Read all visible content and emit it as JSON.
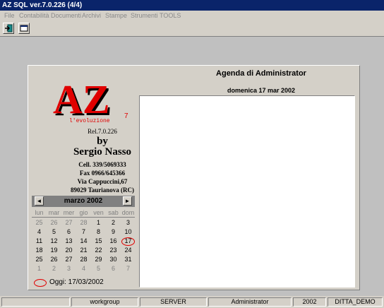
{
  "window": {
    "title": "AZ SQL ver.7.0.226 (4/4)"
  },
  "menu": [
    {
      "label": "File"
    },
    {
      "label": "Contabilità"
    },
    {
      "label": "Documenti"
    },
    {
      "label": "Archivi"
    },
    {
      "label": "Stampe"
    },
    {
      "label": "Strumenti"
    },
    {
      "label": "TOOLS"
    }
  ],
  "toolbar": [
    {
      "icon": "exit-door-icon"
    },
    {
      "icon": "window-icon"
    }
  ],
  "logo": {
    "text": "AZ",
    "superscript": "7",
    "tagline": "l'evoluzione",
    "colors": {
      "red": "#e00000",
      "black": "#000000"
    }
  },
  "info": {
    "release": "Rel.7.0.226",
    "by": "by",
    "author": "Sergio Nasso",
    "contacts": [
      "Cell. 339/5069333",
      "Fax 0966/645366",
      "Via Cappuccini,67",
      "89029 Taurianova (RC)"
    ]
  },
  "agenda": {
    "title": "Agenda di Administrator",
    "date": "domenica 17 mar 2002"
  },
  "calendar": {
    "month": "marzo 2002",
    "prev": "◄",
    "next": "►",
    "weekdays": [
      "lun",
      "mar",
      "mer",
      "gio",
      "ven",
      "sab",
      "dom"
    ],
    "weeks": [
      [
        {
          "d": "25",
          "o": true
        },
        {
          "d": "26",
          "o": true
        },
        {
          "d": "27",
          "o": true
        },
        {
          "d": "28",
          "o": true
        },
        {
          "d": "1"
        },
        {
          "d": "2"
        },
        {
          "d": "3"
        }
      ],
      [
        {
          "d": "4"
        },
        {
          "d": "5"
        },
        {
          "d": "6"
        },
        {
          "d": "7"
        },
        {
          "d": "8"
        },
        {
          "d": "9"
        },
        {
          "d": "10"
        }
      ],
      [
        {
          "d": "11"
        },
        {
          "d": "12"
        },
        {
          "d": "13"
        },
        {
          "d": "14"
        },
        {
          "d": "15"
        },
        {
          "d": "16"
        },
        {
          "d": "17",
          "sel": true
        }
      ],
      [
        {
          "d": "18"
        },
        {
          "d": "19"
        },
        {
          "d": "20"
        },
        {
          "d": "21"
        },
        {
          "d": "22"
        },
        {
          "d": "23"
        },
        {
          "d": "24"
        }
      ],
      [
        {
          "d": "25"
        },
        {
          "d": "26"
        },
        {
          "d": "27"
        },
        {
          "d": "28"
        },
        {
          "d": "29"
        },
        {
          "d": "30"
        },
        {
          "d": "31"
        }
      ],
      [
        {
          "d": "1",
          "o": true
        },
        {
          "d": "2",
          "o": true
        },
        {
          "d": "3",
          "o": true
        },
        {
          "d": "4",
          "o": true
        },
        {
          "d": "5",
          "o": true
        },
        {
          "d": "6",
          "o": true
        },
        {
          "d": "7",
          "o": true
        }
      ]
    ],
    "today": "Oggi: 17/03/2002",
    "ring_color": "#e00000"
  },
  "status": [
    {
      "text": ""
    },
    {
      "text": "workgroup"
    },
    {
      "text": "SERVER"
    },
    {
      "text": "Administrator"
    },
    {
      "text": "2002"
    },
    {
      "text": "DITTA_DEMO"
    }
  ]
}
